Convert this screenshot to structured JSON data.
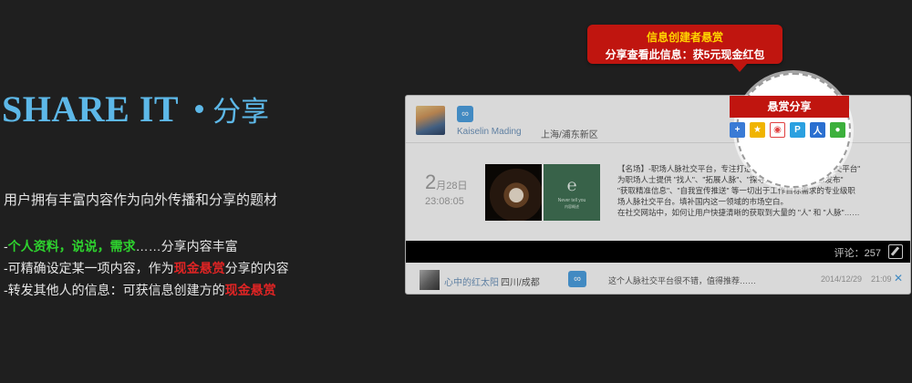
{
  "hero": {
    "title_en": "SHARE IT",
    "title_zh": "分享",
    "description": "用户拥有丰富内容作为向外传播和分享的题材"
  },
  "bullets": [
    {
      "prefix": "-",
      "hl1": "个人资料",
      "sep1": "，",
      "hl2": "说说",
      "sep2": "，",
      "hl3": "需求",
      "rest": "……分享内容丰富"
    },
    {
      "prefix": "-可精确设定某一项内容，作为",
      "hl": "现金悬赏",
      "rest": "分享的内容"
    },
    {
      "prefix": "-转发其他人的信息：可获信息创建方的",
      "hl": "现金悬赏",
      "rest": ""
    }
  ],
  "callout": {
    "line1": "信息创建者悬赏",
    "line2": "分享查看此信息：获5元现金红包"
  },
  "bounty_tab": "悬赏分享",
  "share_icons": [
    "qzone-plus-icon",
    "star-icon",
    "weibo-icon",
    "p-icon",
    "renren-icon",
    "wechat-icon"
  ],
  "card": {
    "author": "Kaiselin Mading",
    "location": "上海/浦东新区",
    "date_num": "2",
    "date_rest": "月28日",
    "time": "23:08:05",
    "image_caption": "Never tell you",
    "image_caption2": "内容概述",
    "body": [
      "【名场】-职场人脉社交平台，专注打造专业级别的 \"职场人脉社交平台\"",
      "为职场人士提供 \"找人\"、\"拓展人脉\"、\"探寻人脉关系\"、\"信息发布\"",
      "\"获取精准信息\"、\"自我宣传推送\" 等一切出于工作目标需求的专业级职",
      "场人脉社交平台。填补国内这一领域的市场空白。",
      "在社交网站中，如何让用户快捷清晰的获取到大量的 \"人\" 和 \"人脉\"……"
    ],
    "comments": "评论：257",
    "foot_user": "心中的红太阳",
    "foot_location": "四川/成都",
    "foot_text": "这个人脉社交平台很不错，值得推荐……",
    "foot_date": "2014/12/29",
    "foot_time": "21:09",
    "foot_close": "✕"
  },
  "colors": {
    "accent_blue": "#5db8e8",
    "highlight_green": "#2ed12e",
    "highlight_red": "#e02424",
    "bounty_red": "#c0150f",
    "callout_yellow": "#ffd200"
  }
}
